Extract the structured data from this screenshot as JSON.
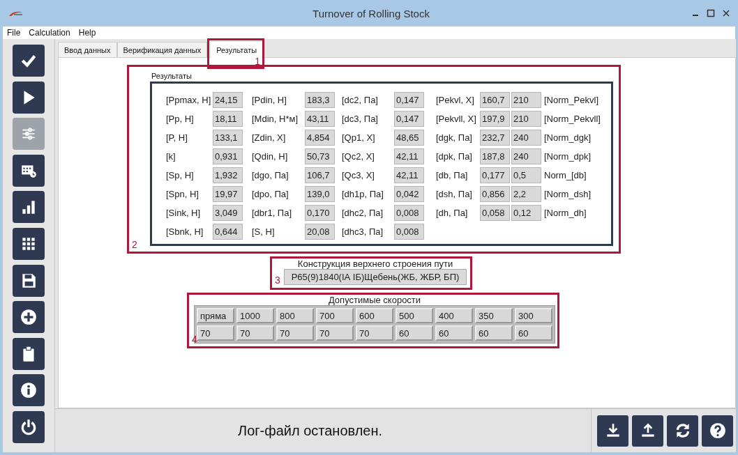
{
  "window": {
    "title": "Turnover of Rolling Stock"
  },
  "menu": [
    "File",
    "Calculation",
    "Help"
  ],
  "sidebar": [
    {
      "kind": "check",
      "disabled": false
    },
    {
      "kind": "play",
      "disabled": false
    },
    {
      "kind": "sliders",
      "disabled": true
    },
    {
      "kind": "calendar",
      "disabled": false
    },
    {
      "kind": "chart",
      "disabled": false
    },
    {
      "kind": "grid",
      "disabled": false
    },
    {
      "kind": "save",
      "disabled": false
    },
    {
      "kind": "add",
      "disabled": false
    },
    {
      "kind": "clipboard",
      "disabled": false
    },
    {
      "kind": "info",
      "disabled": false
    },
    {
      "kind": "power",
      "disabled": false
    }
  ],
  "tabs": [
    {
      "label": "Ввод данных",
      "selected": false
    },
    {
      "label": "Верификация данных",
      "selected": false
    },
    {
      "label": "Результаты",
      "selected": true,
      "callout": "1"
    }
  ],
  "results": {
    "title": "Результаты",
    "callout": "2",
    "rows": [
      [
        {
          "kind": "label",
          "text": "[Ppmax, H]"
        },
        {
          "kind": "value",
          "text": "24,15"
        },
        {
          "kind": "label",
          "text": "[Pdin, H]"
        },
        {
          "kind": "value",
          "text": "183,3"
        },
        {
          "kind": "label",
          "text": "[dc2, Па]"
        },
        {
          "kind": "value",
          "text": "0,147"
        },
        {
          "kind": "label",
          "text": "[Pekvl, X]"
        },
        {
          "kind": "value",
          "text": "160,7"
        },
        {
          "kind": "value",
          "text": "210"
        },
        {
          "kind": "label",
          "text": "[Norm_Pekvl]"
        }
      ],
      [
        {
          "kind": "label",
          "text": "[Pp, H]"
        },
        {
          "kind": "value",
          "text": "18,11"
        },
        {
          "kind": "label",
          "text": "[Mdin, H*м]"
        },
        {
          "kind": "value",
          "text": "43,11"
        },
        {
          "kind": "label",
          "text": "[dc3, Па]"
        },
        {
          "kind": "value",
          "text": "0,147"
        },
        {
          "kind": "label",
          "text": "[Pekvll, X]"
        },
        {
          "kind": "value",
          "text": "197,9"
        },
        {
          "kind": "value",
          "text": "210"
        },
        {
          "kind": "label",
          "text": "[Norm_Pekvll]"
        }
      ],
      [
        {
          "kind": "label",
          "text": "[P, H]"
        },
        {
          "kind": "value",
          "text": "133,1"
        },
        {
          "kind": "label",
          "text": "[Zdin, X]"
        },
        {
          "kind": "value",
          "text": "4,854"
        },
        {
          "kind": "label",
          "text": "[Qp1, X]"
        },
        {
          "kind": "value",
          "text": "48,65"
        },
        {
          "kind": "label",
          "text": "[dgk, Па]"
        },
        {
          "kind": "value",
          "text": "232,7"
        },
        {
          "kind": "value",
          "text": "240"
        },
        {
          "kind": "label",
          "text": "[Norm_dgk]"
        }
      ],
      [
        {
          "kind": "label",
          "text": "[k]"
        },
        {
          "kind": "value",
          "text": "0,931"
        },
        {
          "kind": "label",
          "text": "[Qdin, H]"
        },
        {
          "kind": "value",
          "text": "50,73"
        },
        {
          "kind": "label",
          "text": "[Qc2, X]"
        },
        {
          "kind": "value",
          "text": "42,11"
        },
        {
          "kind": "label",
          "text": "[dpk, Па]"
        },
        {
          "kind": "value",
          "text": "187,8"
        },
        {
          "kind": "value",
          "text": "240"
        },
        {
          "kind": "label",
          "text": "[Norm_dpk]"
        }
      ],
      [
        {
          "kind": "label",
          "text": "[Sp, H]"
        },
        {
          "kind": "value",
          "text": "1,932"
        },
        {
          "kind": "label",
          "text": "[dgo, Па]"
        },
        {
          "kind": "value",
          "text": "106,7"
        },
        {
          "kind": "label",
          "text": "[Qc3, X]"
        },
        {
          "kind": "value",
          "text": "42,11"
        },
        {
          "kind": "label",
          "text": "[db, Па]"
        },
        {
          "kind": "value",
          "text": "0,177"
        },
        {
          "kind": "value",
          "text": "0,5"
        },
        {
          "kind": "label",
          "text": "Norm_[db]"
        }
      ],
      [
        {
          "kind": "label",
          "text": "[Spn, H]"
        },
        {
          "kind": "value",
          "text": "19,97"
        },
        {
          "kind": "label",
          "text": "[dpo, Па]"
        },
        {
          "kind": "value",
          "text": "139,0"
        },
        {
          "kind": "label",
          "text": "[dh1p, Па]"
        },
        {
          "kind": "value",
          "text": "0,042"
        },
        {
          "kind": "label",
          "text": "[dsh, Па]"
        },
        {
          "kind": "value",
          "text": "0,856"
        },
        {
          "kind": "value",
          "text": "2,2"
        },
        {
          "kind": "label",
          "text": "[Norm_dsh]"
        }
      ],
      [
        {
          "kind": "label",
          "text": "[Sink, H]"
        },
        {
          "kind": "value",
          "text": "3,049"
        },
        {
          "kind": "label",
          "text": "[dbr1, Па]"
        },
        {
          "kind": "value",
          "text": "0,170"
        },
        {
          "kind": "label",
          "text": "[dhc2, Па]"
        },
        {
          "kind": "value",
          "text": "0,008"
        },
        {
          "kind": "label",
          "text": "[dh, Па]"
        },
        {
          "kind": "value",
          "text": "0,058"
        },
        {
          "kind": "value",
          "text": "0,12"
        },
        {
          "kind": "label",
          "text": "[Norm_dh]"
        }
      ],
      [
        {
          "kind": "label",
          "text": "[Sbnk, H]"
        },
        {
          "kind": "value",
          "text": "0,644"
        },
        {
          "kind": "label",
          "text": "[S, H]"
        },
        {
          "kind": "value",
          "text": "20,08"
        },
        {
          "kind": "label",
          "text": "[dhc3, Па]"
        },
        {
          "kind": "value",
          "text": "0,008"
        }
      ]
    ]
  },
  "construction": {
    "title": "Конструкция верхнего строения пути",
    "value": "Р65(9)1840(IА IБ)Щебень(ЖБ, ЖБР, БП)",
    "callout": "3"
  },
  "speeds": {
    "title": "Допустимые скорости",
    "callout": "4",
    "rows": [
      [
        "пряма",
        "1000",
        "800",
        "700",
        "600",
        "500",
        "400",
        "350",
        "300"
      ],
      [
        "70",
        "70",
        "70",
        "70",
        "70",
        "60",
        "60",
        "60",
        "60"
      ]
    ]
  },
  "status": "Лог-файл остановлен.",
  "bottom_buttons": [
    {
      "kind": "download"
    },
    {
      "kind": "upload"
    },
    {
      "kind": "refresh"
    },
    {
      "kind": "help"
    }
  ]
}
